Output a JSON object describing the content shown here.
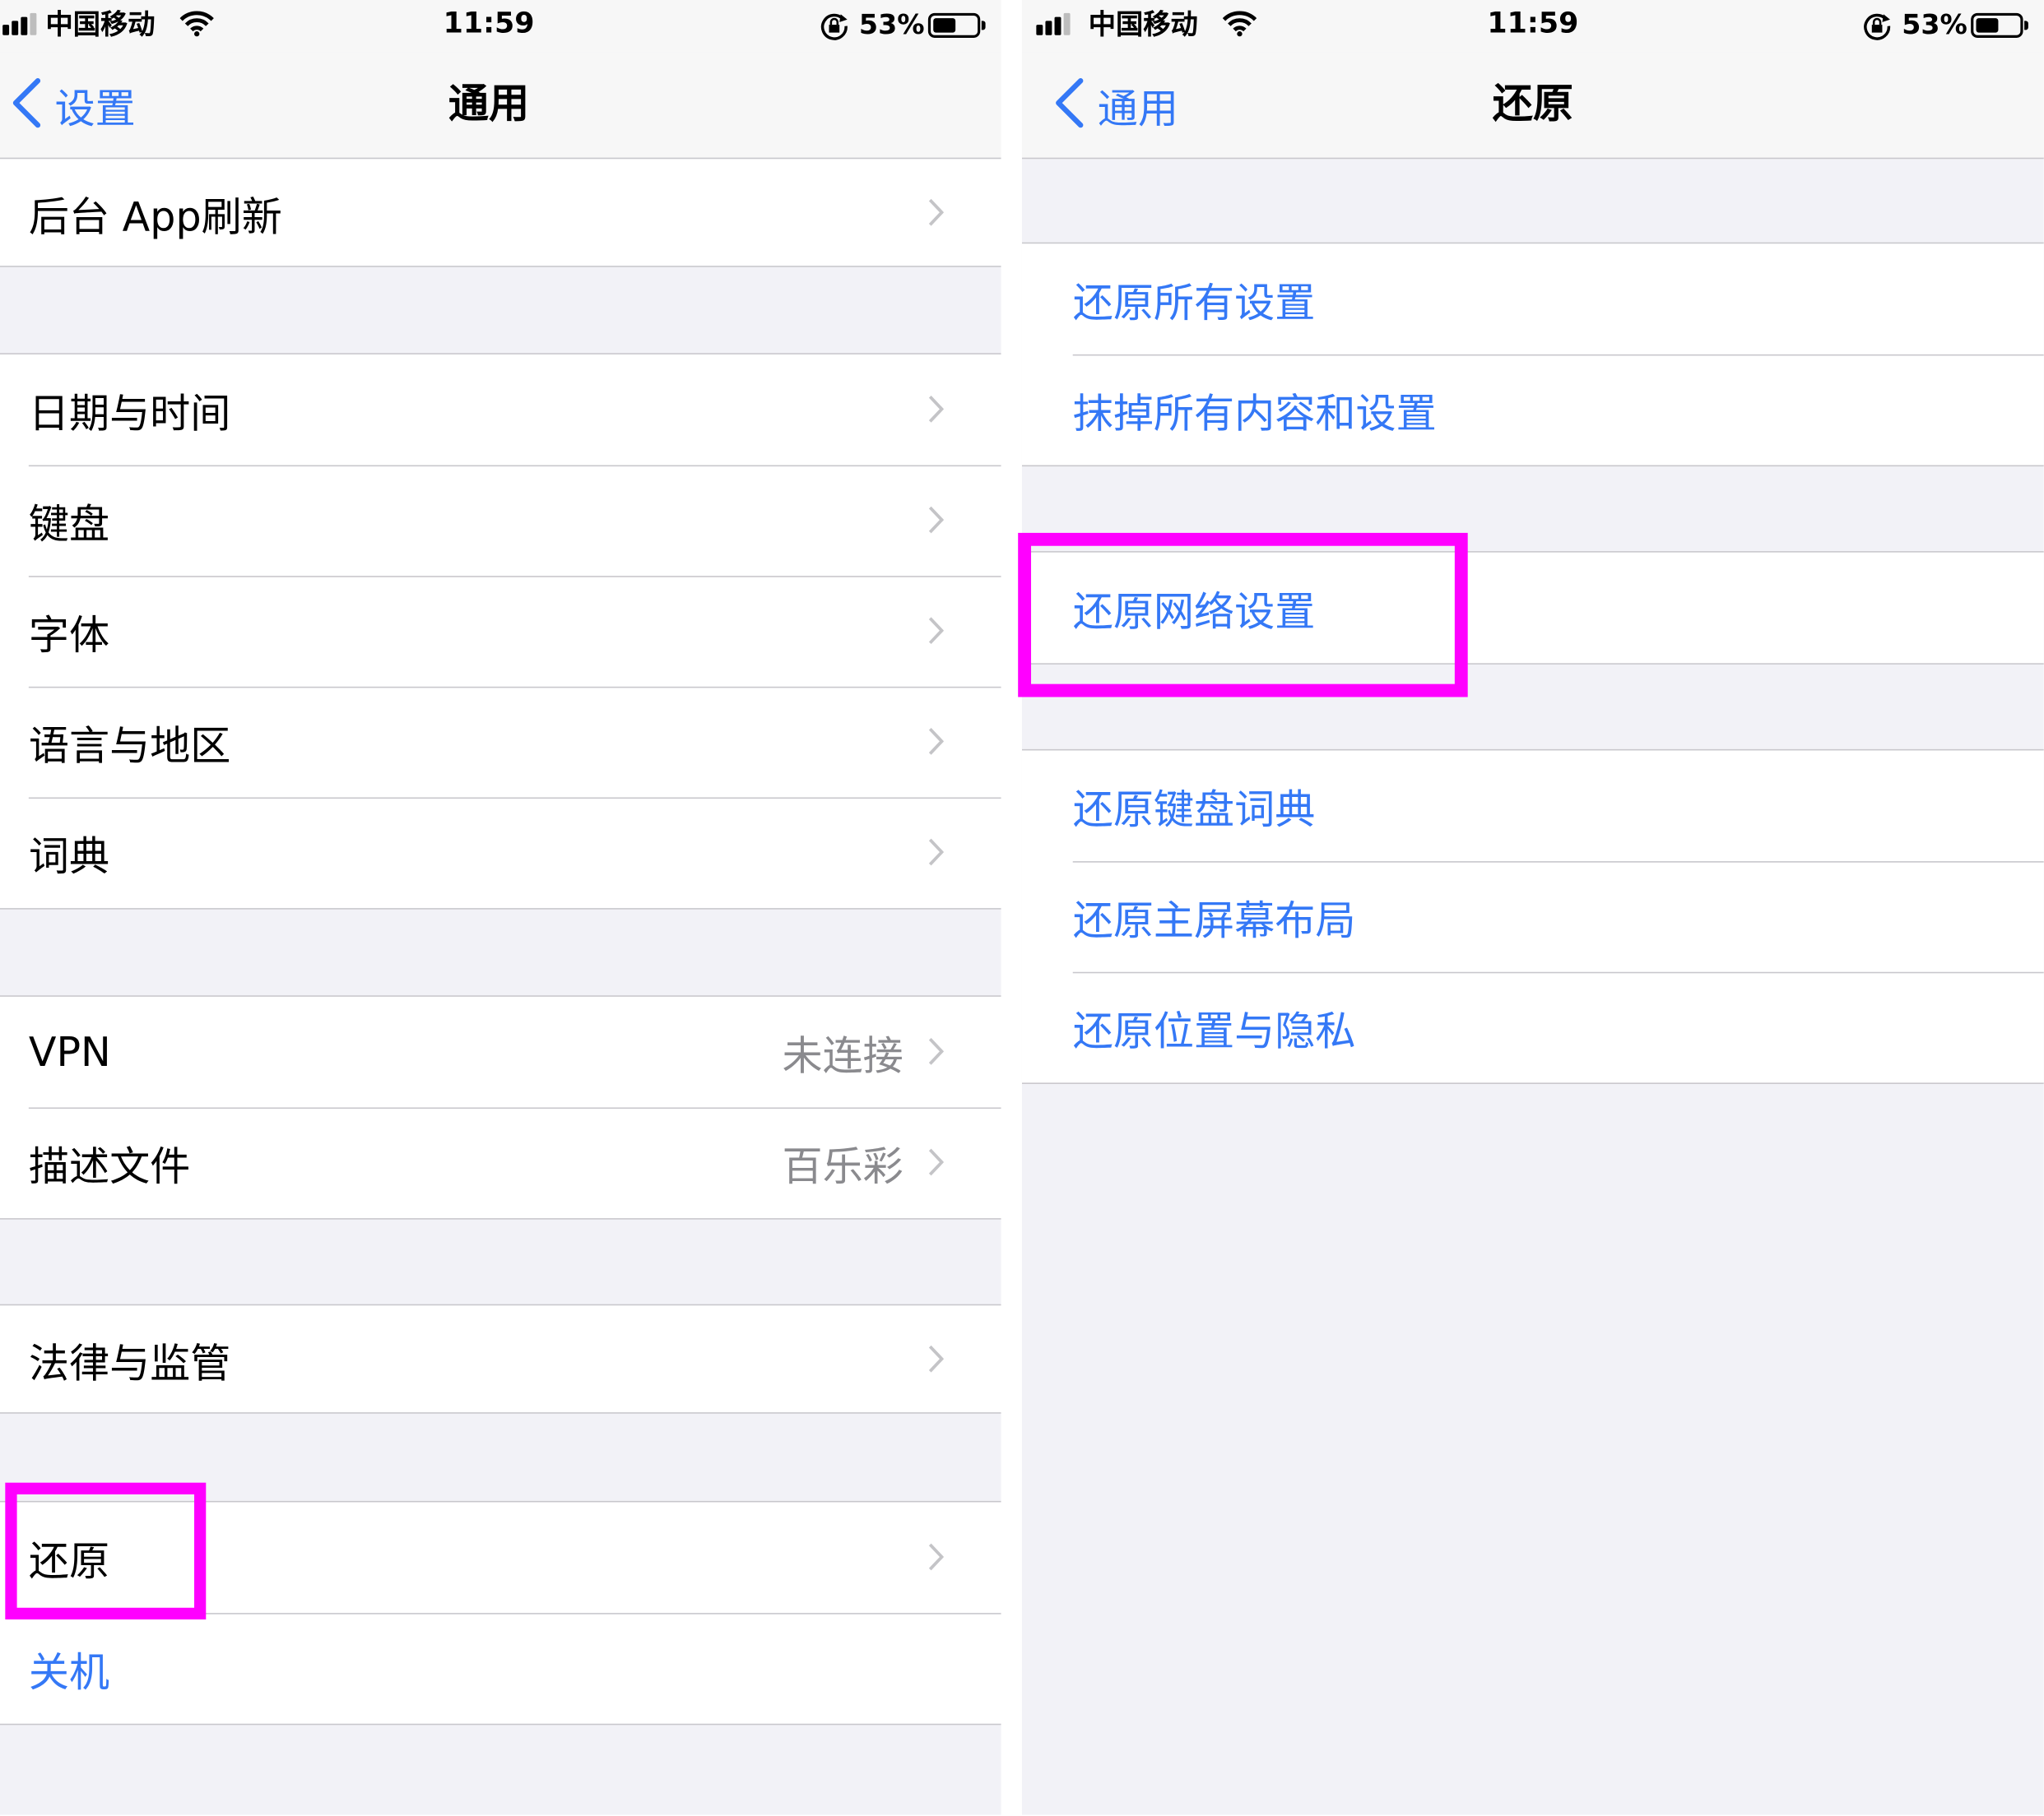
{
  "left": {
    "status": {
      "carrier": "中国移动",
      "time": "11:59",
      "battery": "53%",
      "battery_level": 0.53
    },
    "nav": {
      "back_label": "设置",
      "title": "通用"
    },
    "groups": [
      {
        "rows": [
          {
            "label": "后台 App刷新"
          }
        ]
      },
      {
        "rows": [
          {
            "label": "日期与时间"
          },
          {
            "label": "键盘"
          },
          {
            "label": "字体"
          },
          {
            "label": "语言与地区"
          },
          {
            "label": "词典"
          }
        ]
      },
      {
        "rows": [
          {
            "label": "VPN",
            "value": "未连接"
          },
          {
            "label": "描述文件",
            "value": "百乐彩"
          }
        ]
      },
      {
        "rows": [
          {
            "label": "法律与监管"
          }
        ]
      },
      {
        "rows": [
          {
            "label": "还原"
          },
          {
            "label": "关机"
          }
        ]
      }
    ]
  },
  "right": {
    "status": {
      "carrier": "中国移动",
      "time": "11:59",
      "battery": "53%",
      "battery_level": 0.53
    },
    "nav": {
      "back_label": "通用",
      "title": "还原"
    },
    "groups": [
      {
        "rows": [
          {
            "label": "还原所有设置"
          },
          {
            "label": "抹掉所有内容和设置"
          }
        ]
      },
      {
        "rows": [
          {
            "label": "还原网络设置"
          }
        ]
      },
      {
        "rows": [
          {
            "label": "还原键盘词典"
          },
          {
            "label": "还原主屏幕布局"
          },
          {
            "label": "还原位置与隐私"
          }
        ]
      }
    ]
  },
  "icons": {
    "signal": "cellular-signal-icon",
    "wifi": "wifi-icon",
    "rotation_lock": "rotation-lock-icon",
    "battery": "battery-icon",
    "back": "chevron-left-icon",
    "disclosure": "chevron-right-icon"
  },
  "colors": {
    "accent": "#3478F6",
    "highlight": "#FF00FF",
    "background": "#F2F2F7",
    "separator": "#C8C7CC",
    "secondary_text": "#8A8A8E"
  }
}
